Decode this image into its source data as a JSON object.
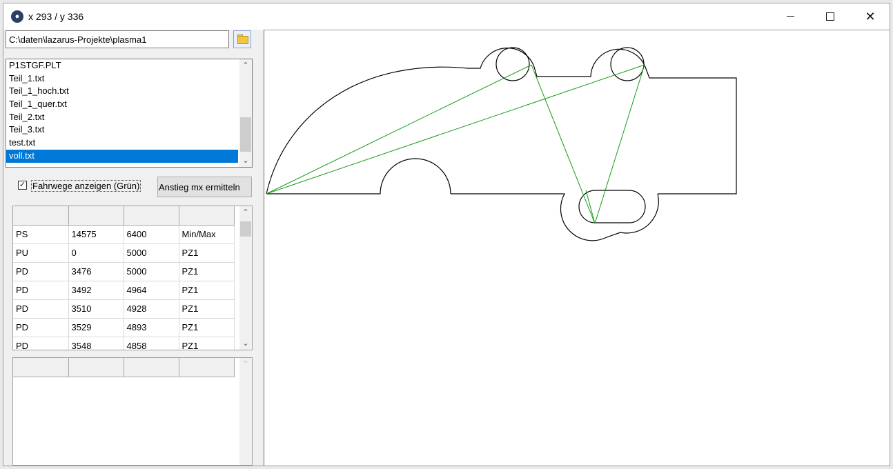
{
  "window": {
    "title": "x 293 / y 336",
    "app_icon": "paw-icon",
    "controls": [
      "minimize-icon",
      "maximize-icon",
      "close-icon"
    ]
  },
  "path_field": {
    "value": "C:\\daten\\lazarus-Projekte\\plasma1",
    "browse_icon": "folder-icon"
  },
  "file_list": {
    "items": [
      "P1STGF.PLT",
      "Teil_1.txt",
      "Teil_1_hoch.txt",
      "Teil_1_quer.txt",
      "Teil_2.txt",
      "Teil_3.txt",
      "test.txt",
      "voll.txt"
    ],
    "selected": "voll.txt"
  },
  "options": {
    "show_paths_label": "Fahrwege anzeigen (Grün)",
    "show_paths_checked": true,
    "slope_button_label": "Anstieg mx ermitteln"
  },
  "command_table": {
    "columns": [
      "",
      "",
      "",
      ""
    ],
    "rows": [
      [
        "PS",
        "14575",
        "6400",
        "Min/Max"
      ],
      [
        "PU",
        "0",
        "5000",
        "PZ1"
      ],
      [
        "PD",
        "3476",
        "5000",
        "PZ1"
      ],
      [
        "PD",
        "3492",
        "4964",
        "PZ1"
      ],
      [
        "PD",
        "3510",
        "4928",
        "PZ1"
      ],
      [
        "PD",
        "3529",
        "4893",
        "PZ1"
      ],
      [
        "PD",
        "3548",
        "4858",
        "PZ1"
      ]
    ]
  },
  "second_table": {
    "columns": [
      "",
      "",
      "",
      ""
    ],
    "rows": []
  },
  "drawing": {
    "outline_color": "#000000",
    "travel_path_color": "#139913"
  }
}
